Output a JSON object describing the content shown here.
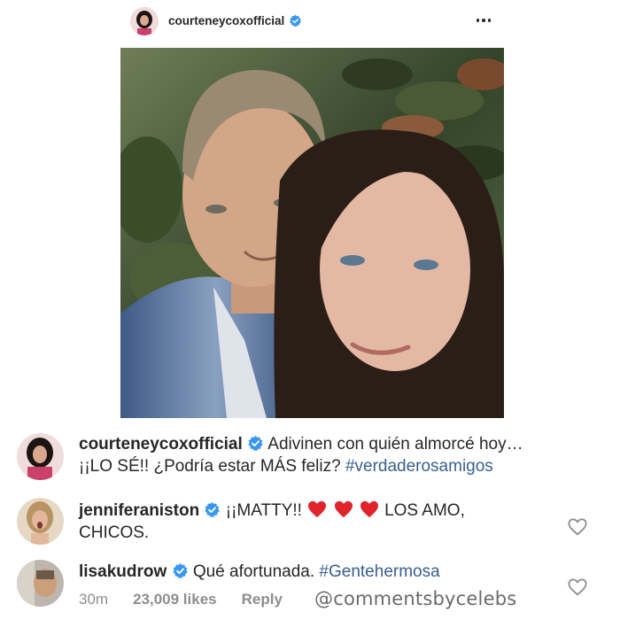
{
  "post": {
    "username": "courteneycoxofficial",
    "more_icon": "more-horizontal-icon"
  },
  "comments": [
    {
      "username": "courteneycoxofficial",
      "text_line1": "Adivinen con quién almorcé hoy…",
      "text_line2": "¡¡LO SÉ!! ¿Podría estar MÁS feliz?",
      "hashtag": "#verdaderosamigos"
    },
    {
      "username": "jenniferaniston",
      "text_a": "¡¡MATTY!!",
      "text_b": "LOS AMO,",
      "text_line2": "CHICOS."
    },
    {
      "username": "lisakudrow",
      "text": "Qué afortunada.",
      "hashtag": "#Gentehermosa"
    }
  ],
  "meta": {
    "time": "30m",
    "likes": "23,009 likes",
    "reply": "Reply"
  },
  "watermark": "@commentsbycelebs",
  "colors": {
    "verified_blue": "#3897f0",
    "hashtag": "#385f8f",
    "heart_red": "#e0242b",
    "muted": "#8e8e8e"
  }
}
